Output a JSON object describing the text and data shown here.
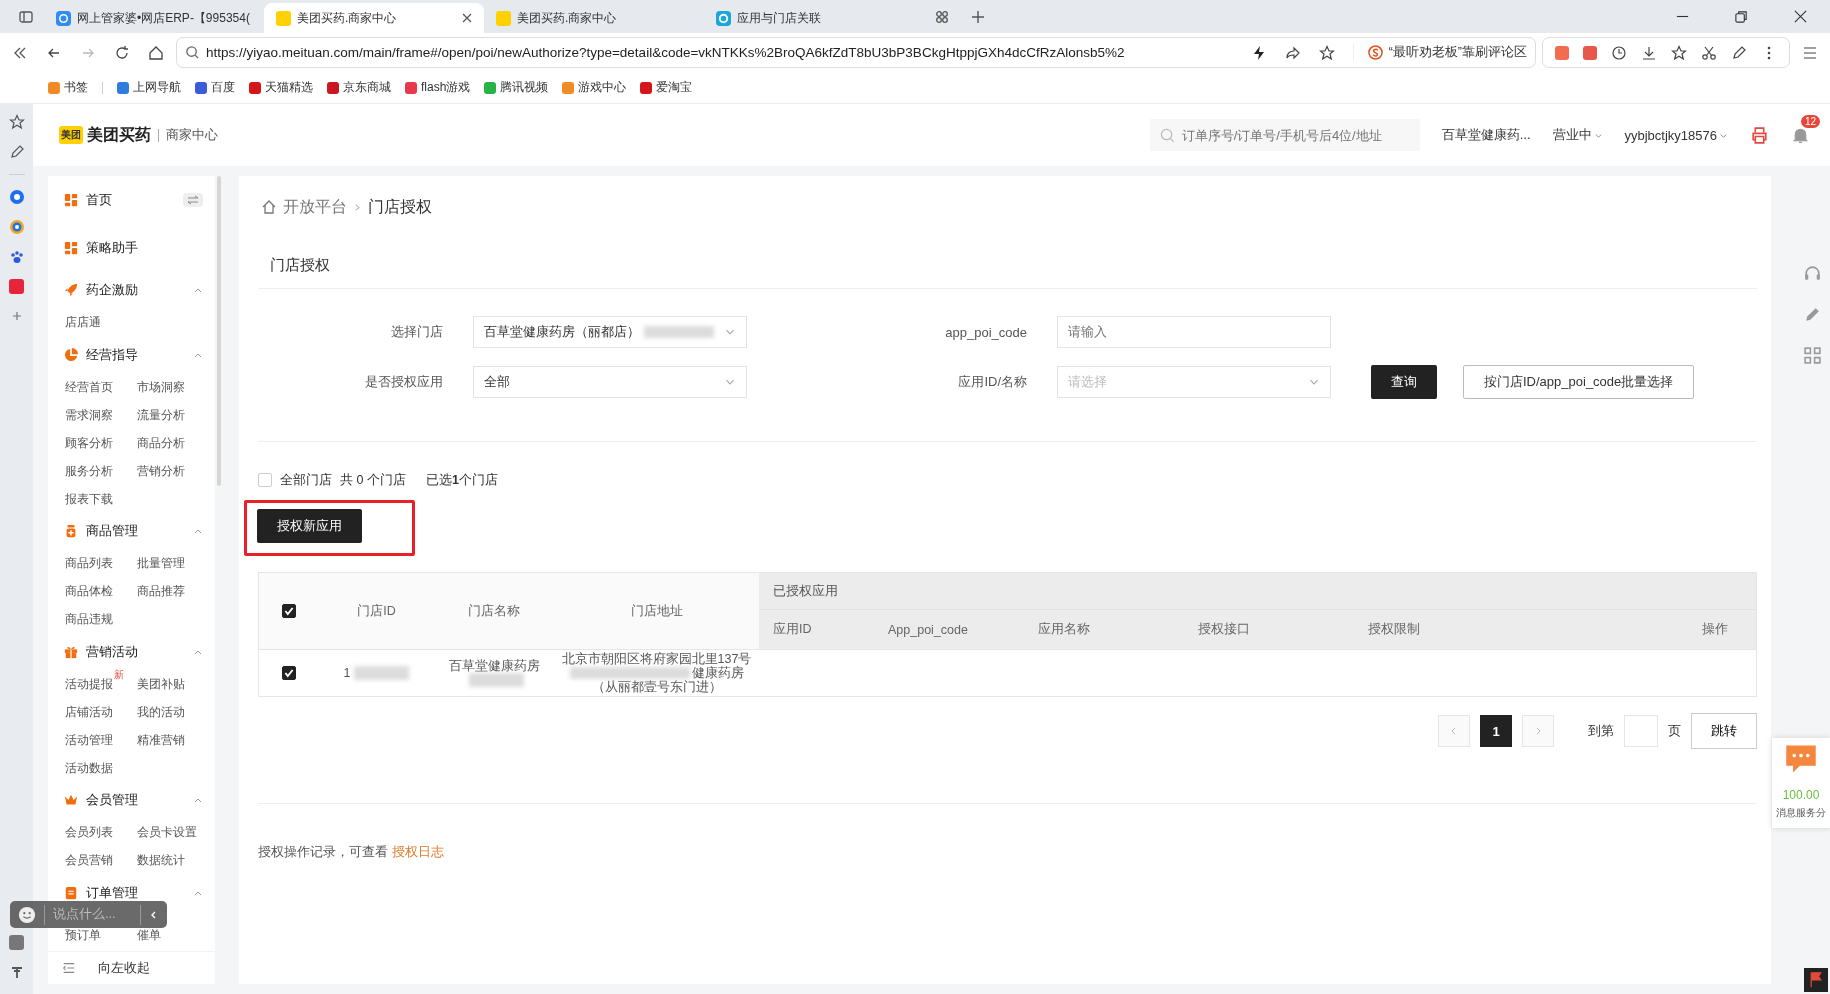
{
  "browser": {
    "tabs": [
      {
        "title": "网上管家婆•网店ERP-【995354(",
        "kind": "erp",
        "selected": false
      },
      {
        "title": "美团买药.商家中心",
        "kind": "meituan",
        "selected": true
      },
      {
        "title": "美团买药.商家中心",
        "kind": "meituan",
        "selected": false
      },
      {
        "title": "应用与门店关联",
        "kind": "app",
        "selected": false
      }
    ],
    "url": "https://yiyao.meituan.com/main/frame#/open/poi/newAuthorize?type=detail&code=vkNTKKs%2BroQA6kfZdT8bU3bP3BCkgHtppjGXh4dcCfRzAlonsb5%2",
    "news": "“最听劝老板”靠刷评论区",
    "bookmarks": [
      {
        "label": "书签",
        "color": "#f08a24"
      },
      {
        "label": "上网导航",
        "color": "#2f7de1"
      },
      {
        "label": "百度",
        "color": "#3b5bdb"
      },
      {
        "label": "天猫精选",
        "color": "#d7141a"
      },
      {
        "label": "京东商城",
        "color": "#c91623"
      },
      {
        "label": "flash游戏",
        "color": "#e8384f"
      },
      {
        "label": "腾讯视频",
        "color": "#27b24a"
      },
      {
        "label": "游戏中心",
        "color": "#f08a24"
      },
      {
        "label": "爱淘宝",
        "color": "#d7141a"
      }
    ]
  },
  "header": {
    "logo_badge": "美团",
    "brand": "美团买药",
    "subtitle": "商家中心",
    "search": {
      "placeholder": "订单序号/订单号/手机号后4位/地址"
    },
    "store": "百草堂健康药...",
    "status": "营业中",
    "user": "yybjbctjky18576",
    "notifications": "12"
  },
  "sidebar": {
    "items": [
      {
        "label": "首页",
        "kind": "link"
      },
      {
        "label": "策略助手",
        "kind": "link"
      },
      {
        "label": "药企激励",
        "kind": "group",
        "expanded": true,
        "children": [
          {
            "label": "店店通"
          }
        ]
      },
      {
        "label": "经营指导",
        "kind": "group",
        "expanded": true,
        "children": [
          {
            "label": "经营首页"
          },
          {
            "label": "市场洞察"
          },
          {
            "label": "需求洞察"
          },
          {
            "label": "流量分析"
          },
          {
            "label": "顾客分析"
          },
          {
            "label": "商品分析"
          },
          {
            "label": "服务分析"
          },
          {
            "label": "营销分析"
          },
          {
            "label": "报表下载"
          }
        ]
      },
      {
        "label": "商品管理",
        "kind": "group",
        "expanded": true,
        "children": [
          {
            "label": "商品列表"
          },
          {
            "label": "批量管理"
          },
          {
            "label": "商品体检"
          },
          {
            "label": "商品推荐"
          },
          {
            "label": "商品违规"
          }
        ]
      },
      {
        "label": "营销活动",
        "kind": "group",
        "expanded": true,
        "children": [
          {
            "label": "活动提报",
            "badge": "新"
          },
          {
            "label": "美团补贴"
          },
          {
            "label": "店铺活动"
          },
          {
            "label": "我的活动"
          },
          {
            "label": "活动管理"
          },
          {
            "label": "精准营销"
          },
          {
            "label": "活动数据"
          }
        ]
      },
      {
        "label": "会员管理",
        "kind": "group",
        "expanded": true,
        "children": [
          {
            "label": "会员列表"
          },
          {
            "label": "会员卡设置"
          },
          {
            "label": "会员营销"
          },
          {
            "label": "数据统计"
          }
        ]
      },
      {
        "label": "订单管理",
        "kind": "group",
        "expanded": true,
        "children": [
          {
            "label": "预订单"
          },
          {
            "label": "催单"
          }
        ]
      }
    ],
    "collapse": "向左收起"
  },
  "breadcrumb": [
    "开放平台",
    "门店授权"
  ],
  "section_title": "门店授权",
  "filters": [
    {
      "label": "选择门店",
      "kind": "select",
      "value": "百草堂健康药房（丽都店）",
      "redacted": true
    },
    {
      "label": "app_poi_code",
      "kind": "input",
      "placeholder": "请输入"
    },
    {
      "label": "是否授权应用",
      "kind": "select",
      "value": "全部"
    },
    {
      "label": "应用ID/名称",
      "kind": "select",
      "placeholder": "请选择"
    }
  ],
  "buttons": [
    {
      "label": "查询",
      "kind": "primary"
    },
    {
      "label": "按门店ID/app_poi_code批量选择",
      "kind": "default"
    }
  ],
  "selection": {
    "all_label": "全部门店",
    "checked": false,
    "total": "共 0 个门店",
    "selected_text": "已选**1**个门店"
  },
  "authorize_button": {
    "label": "授权新应用",
    "highlighted": true
  },
  "table": {
    "all_checked": true,
    "columns": [
      "门店ID",
      "门店名称",
      "门店地址"
    ],
    "group_header": "已授权应用",
    "group_columns": [
      "应用ID",
      "App_poi_code",
      "应用名称",
      "授权接口",
      "授权限制",
      "操作"
    ],
    "rows": [
      {
        "checked": true,
        "redacted": true,
        "id": "1",
        "name": "百草堂健康药房",
        "address": [
          "北京市朝阳区将府家园北里137号",
          "健康药房",
          "（从丽都壹号东门进）"
        ]
      }
    ]
  },
  "pagination": {
    "pages": [
      {
        "label": "1",
        "selected": true
      }
    ],
    "goto_label": "到第",
    "page_label": "页",
    "jump": "跳转"
  },
  "footer": {
    "text": "授权操作记录，可查看",
    "link": "授权日志"
  },
  "float_panel": {
    "score": "100.00",
    "score_label": "消息服务分"
  },
  "chat_overlay": {
    "placeholder": "说点什么..."
  }
}
